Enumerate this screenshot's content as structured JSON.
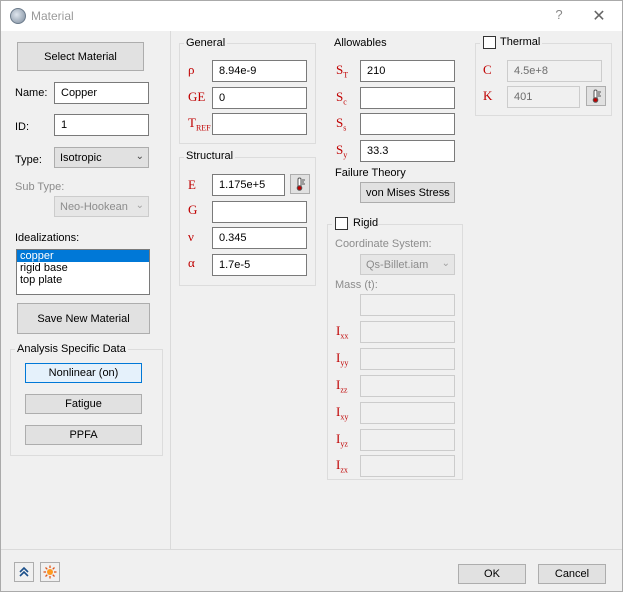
{
  "window": {
    "title": "Material",
    "help": "?",
    "close": "✕"
  },
  "left": {
    "select_material": "Select Material",
    "name_label": "Name:",
    "name_value": "Copper",
    "id_label": "ID:",
    "id_value": "1",
    "type_label": "Type:",
    "type_value": "Isotropic",
    "subtype_label": "Sub Type:",
    "subtype_value": "Neo-Hookean",
    "idealizations_label": "Idealizations:",
    "idealizations": [
      "copper",
      "rigid base",
      "top plate"
    ],
    "save_new": "Save New Material",
    "analysis_group": "Analysis Specific Data",
    "nonlinear": "Nonlinear (on)",
    "fatigue": "Fatigue",
    "ppfa": "PPFA"
  },
  "general": {
    "title": "General",
    "rho_symbol": "ρ",
    "rho_value": "8.94e-9",
    "ge_symbol": "GE",
    "ge_value": "0",
    "tref_symbol": "T",
    "tref_sub": "REF",
    "tref_value": ""
  },
  "structural": {
    "title": "Structural",
    "e_symbol": "E",
    "e_value": "1.175e+5",
    "g_symbol": "G",
    "g_value": "",
    "nu_symbol": "ν",
    "nu_value": "0.345",
    "alpha_symbol": "α",
    "alpha_value": "1.7e-5"
  },
  "allowables": {
    "title": "Allowables",
    "st_symbol": "S",
    "st_sub": "T",
    "st_value": "210",
    "sc_symbol": "S",
    "sc_sub": "c",
    "sc_value": "",
    "ss_symbol": "S",
    "ss_sub": "s",
    "ss_value": "",
    "sy_symbol": "S",
    "sy_sub": "y",
    "sy_value": "33.3",
    "failure_label": "Failure Theory",
    "failure_value": "von Mises Stress"
  },
  "rigid": {
    "title": "Rigid",
    "coord_label": "Coordinate System:",
    "coord_value": "Qs-Billet.iam",
    "mass_label": "Mass (t):",
    "i_symbol": "I",
    "i_subs": [
      "xx",
      "yy",
      "zz",
      "xy",
      "yz",
      "zx"
    ]
  },
  "thermal": {
    "title": "Thermal",
    "c_symbol": "C",
    "c_value": "4.5e+8",
    "k_symbol": "K",
    "k_value": "401"
  },
  "footer": {
    "ok": "OK",
    "cancel": "Cancel"
  },
  "icons": {
    "thermometer": "thermometer-icon",
    "collapse": "double-chevron-up-icon",
    "burst": "starburst-icon"
  },
  "colors": {
    "accent": "#0078d7",
    "symbol": "#c00000"
  }
}
